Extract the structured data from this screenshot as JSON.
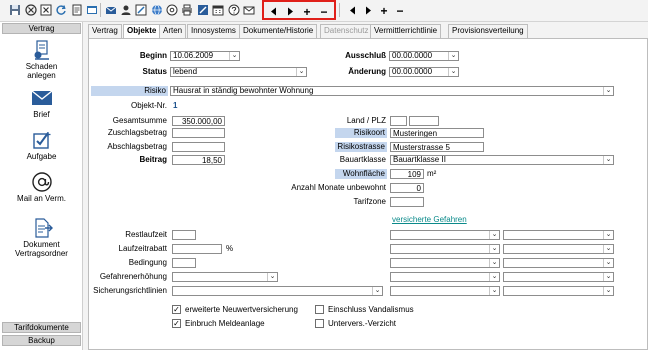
{
  "colors": {
    "highlight": "#c4d6ee",
    "nav_box": "#e0201a",
    "link": "#0a8a8a"
  },
  "toolbar": {
    "icons": [
      "save-icon",
      "delete-icon",
      "cancel-icon",
      "refresh-icon",
      "document-icon",
      "window-icon",
      "mail-icon",
      "person-icon",
      "edit-icon",
      "globe-icon",
      "at-sign-icon",
      "print-icon",
      "compose-icon",
      "calendar-icon",
      "help-icon",
      "email-icon"
    ],
    "nav_prev": "◀",
    "nav_next": "▶",
    "nav_add": "+",
    "nav_remove": "−"
  },
  "sidebar": {
    "header_top": "Vertrag",
    "items": [
      {
        "icon": "damage-report-icon",
        "label1": "Schaden",
        "label2": "anlegen"
      },
      {
        "icon": "letter-icon",
        "label1": "Brief",
        "label2": ""
      },
      {
        "icon": "task-icon",
        "label1": "Aufgabe",
        "label2": ""
      },
      {
        "icon": "mail-at-icon",
        "label1": "Mail an Verm.",
        "label2": ""
      },
      {
        "icon": "folder-document-icon",
        "label1": "Dokument",
        "label2": "Vertragsordner"
      }
    ],
    "footer1": "Tarifdokumente",
    "footer2": "Backup"
  },
  "tabs": [
    "Vertrag",
    "Objekte",
    "Arten",
    "Innosystems",
    "Dokumente/Historie",
    "Datenschutz",
    "Vermittlerrichtlinie",
    "Provisionsverteilung"
  ],
  "form": {
    "beginn_label": "Beginn",
    "beginn_value": "10.06.2009",
    "ausschluss_label": "Ausschluß",
    "ausschluss_value": "00.00.0000",
    "status_label": "Status",
    "status_value": "lebend",
    "aenderung_label": "Änderung",
    "aenderung_value": "00.00.0000",
    "risiko_label": "Risiko",
    "risiko_value": "Hausrat in ständig bewohnter Wohnung",
    "objekt_nr_label": "Objekt-Nr.",
    "objekt_nr_value": "1",
    "gesamtsumme_label": "Gesamtsumme",
    "gesamtsumme_value": "350.000,00",
    "zuschlag_label": "Zuschlagsbetrag",
    "zuschlag_value": "",
    "abschlag_label": "Abschlagsbetrag",
    "abschlag_value": "",
    "beitrag_label": "Beitrag",
    "beitrag_value": "18,50",
    "land_plz_label": "Land / PLZ",
    "land_value": "",
    "plz_value": "",
    "risikoort_label": "Risikoort",
    "risikoort_value": "Musteringen",
    "risikostrasse_label": "Risikostrasse",
    "risikostrasse_value": "Musterstrasse 5",
    "bauartklasse_label": "Bauartklasse",
    "bauartklasse_value": "Bauartklasse II",
    "wohnflaeche_label": "Wohnfläche",
    "wohnflaeche_value": "109",
    "wohnflaeche_unit": "m²",
    "monate_label": "Anzahl Monate unbewohnt",
    "monate_value": "0",
    "tarifzone_label": "Tarifzone",
    "tarifzone_value": "",
    "gefahren_link": "versicherte Gefahren",
    "restlaufzeit_label": "Restlaufzeit",
    "restlaufzeit_value": "",
    "laufzeitrabatt_label": "Laufzeitrabatt",
    "laufzeitrabatt_value": "",
    "percent": "%",
    "bedingung_label": "Bedingung",
    "bedingung_value": "",
    "gefahrenerhoehung_label": "Gefahrenerhöhung",
    "sicherung_label": "Sicherungsrichtlinien",
    "checkboxes": [
      {
        "label": "erweiterte Neuwertversicherung",
        "checked": true
      },
      {
        "label": "Einbruch Meldeanlage",
        "checked": true
      },
      {
        "label": "Einschluss Vandalismus",
        "checked": false
      },
      {
        "label": "Untervers.-Verzicht",
        "checked": false
      }
    ],
    "check_mark": "✓"
  }
}
